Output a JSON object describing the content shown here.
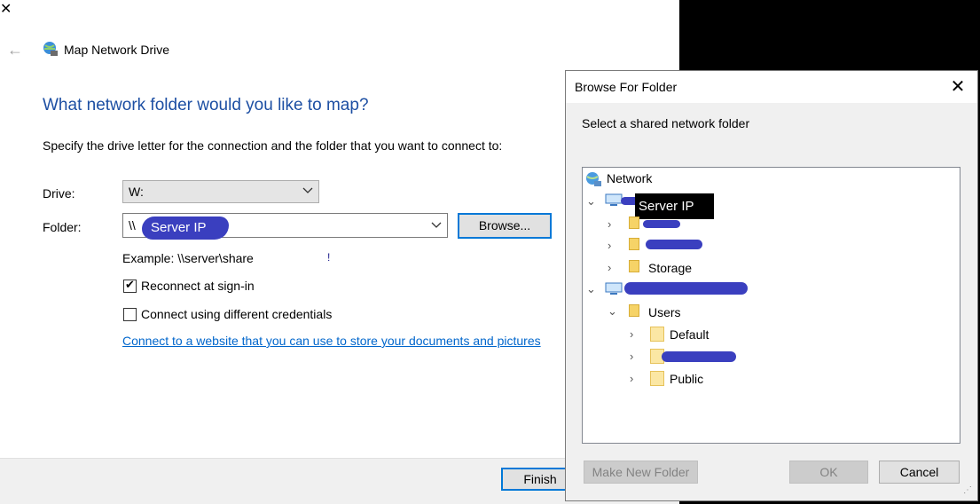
{
  "wizard": {
    "title": "Map Network Drive",
    "heading": "What network folder would you like to map?",
    "instruction": "Specify the drive letter for the connection and the folder that you want to connect to:",
    "drive_label": "Drive:",
    "drive_value": "W:",
    "folder_label": "Folder:",
    "folder_value_prefix": "\\\\",
    "folder_redacted_note": "Server IP",
    "browse_label": "Browse...",
    "example": "Example: \\\\server\\share",
    "reconnect_label": "Reconnect at sign-in",
    "reconnect_checked": true,
    "credentials_label": "Connect using different credentials",
    "credentials_checked": false,
    "link_text": "Connect to a website that you can use to store your documents and pictures",
    "finish_label": "Finish"
  },
  "browse": {
    "title": "Browse For Folder",
    "instruction": "Select a shared network folder",
    "tree": {
      "root": "Network",
      "server_tooltip": "Server IP",
      "server1_children": [
        "",
        "",
        "Storage"
      ],
      "server2_children": {
        "users": "Users",
        "users_children": [
          "Default",
          "",
          "Public"
        ]
      }
    },
    "make_new_folder_label": "Make New Folder",
    "ok_label": "OK",
    "cancel_label": "Cancel"
  },
  "colors": {
    "heading_blue": "#1d4fa3",
    "link_blue": "#0066cc",
    "focus_blue": "#0078d7",
    "redaction": "#3a3fbf"
  }
}
